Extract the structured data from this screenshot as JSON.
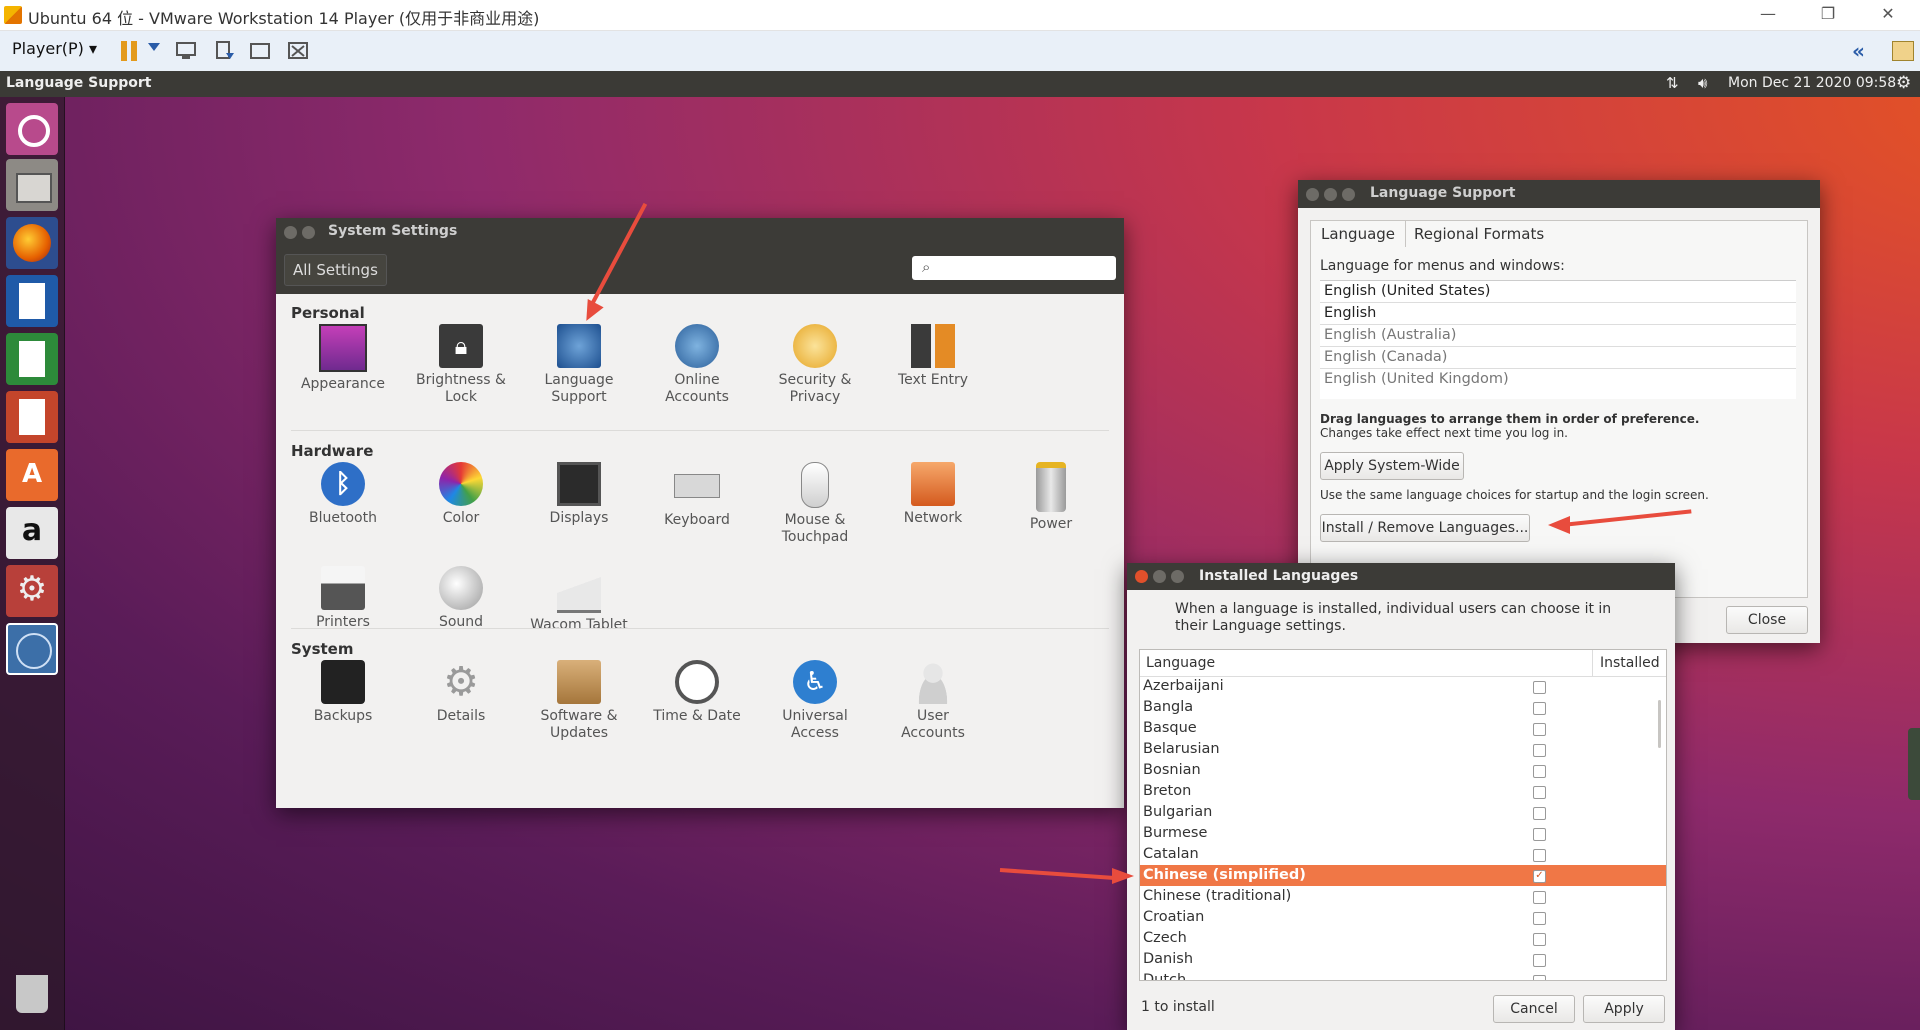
{
  "vm": {
    "window_title": "Ubuntu 64 位 - VMware Workstation 14 Player (仅用于非商业用途)",
    "player_menu": "Player(P) ▾",
    "icons": [
      "pause-icon",
      "dropdown-icon",
      "send-ctrl-alt-del-icon",
      "removable-devices-icon",
      "fullscreen-icon",
      "unity-icon",
      "collapse-icon",
      "library-icon"
    ]
  },
  "topbar": {
    "app_name": "Language Support",
    "clock": "Mon Dec 21 2020 09:58"
  },
  "launcher": [
    "ubuntu-dash-icon",
    "files-icon",
    "firefox-icon",
    "writer-icon",
    "calc-icon",
    "impress-icon",
    "software-center-icon",
    "amazon-icon",
    "system-settings-icon",
    "language-support-icon",
    "trash-icon"
  ],
  "system_settings": {
    "title": "System Settings",
    "all_settings": "All Settings",
    "sections": [
      {
        "name": "Personal",
        "items": [
          {
            "label": "Appearance",
            "icon": "appearance-icon"
          },
          {
            "label": "Brightness &\nLock",
            "icon": "lock-icon"
          },
          {
            "label": "Language\nSupport",
            "icon": "language-icon"
          },
          {
            "label": "Online\nAccounts",
            "icon": "online-accounts-icon"
          },
          {
            "label": "Security &\nPrivacy",
            "icon": "security-icon"
          },
          {
            "label": "Text Entry",
            "icon": "keyboard-layout-icon"
          }
        ]
      },
      {
        "name": "Hardware",
        "items": [
          {
            "label": "Bluetooth",
            "icon": "bluetooth-icon"
          },
          {
            "label": "Color",
            "icon": "color-icon"
          },
          {
            "label": "Displays",
            "icon": "display-icon"
          },
          {
            "label": "Keyboard",
            "icon": "keyboard-icon"
          },
          {
            "label": "Mouse &\nTouchpad",
            "icon": "mouse-icon"
          },
          {
            "label": "Network",
            "icon": "network-icon"
          },
          {
            "label": "Power",
            "icon": "power-icon"
          },
          {
            "label": "Printers",
            "icon": "printer-icon"
          },
          {
            "label": "Sound",
            "icon": "sound-icon"
          },
          {
            "label": "Wacom Tablet",
            "icon": "tablet-icon"
          }
        ]
      },
      {
        "name": "System",
        "items": [
          {
            "label": "Backups",
            "icon": "backup-icon"
          },
          {
            "label": "Details",
            "icon": "gear-icon"
          },
          {
            "label": "Software &\nUpdates",
            "icon": "software-icon"
          },
          {
            "label": "Time & Date",
            "icon": "clock-icon"
          },
          {
            "label": "Universal\nAccess",
            "icon": "accessibility-icon"
          },
          {
            "label": "User\nAccounts",
            "icon": "users-icon"
          }
        ]
      }
    ]
  },
  "language_support": {
    "title": "Language Support",
    "tabs": [
      "Language",
      "Regional Formats"
    ],
    "menus_label": "Language for menus and windows:",
    "languages": [
      "English (United States)",
      "English",
      "English (Australia)",
      "English (Canada)",
      "English (United Kingdom)"
    ],
    "drag_hint": "Drag languages to arrange them in order of preference.",
    "drag_hint2": "Changes take effect next time you log in.",
    "apply_system_wide": "Apply System-Wide",
    "system_wide_hint": "Use the same language choices for startup and the login screen.",
    "install_remove": "Install / Remove Languages...",
    "close": "Close"
  },
  "installed_languages": {
    "title": "Installed Languages",
    "description": "When a language is installed, individual users can choose it in their Language settings.",
    "col_language": "Language",
    "col_installed": "Installed",
    "rows": [
      {
        "name": "Azerbaijani",
        "checked": false
      },
      {
        "name": "Bangla",
        "checked": false
      },
      {
        "name": "Basque",
        "checked": false
      },
      {
        "name": "Belarusian",
        "checked": false
      },
      {
        "name": "Bosnian",
        "checked": false
      },
      {
        "name": "Breton",
        "checked": false
      },
      {
        "name": "Bulgarian",
        "checked": false
      },
      {
        "name": "Burmese",
        "checked": false
      },
      {
        "name": "Catalan",
        "checked": false
      },
      {
        "name": "Chinese (simplified)",
        "checked": true,
        "selected": true
      },
      {
        "name": "Chinese (traditional)",
        "checked": false
      },
      {
        "name": "Croatian",
        "checked": false
      },
      {
        "name": "Czech",
        "checked": false
      },
      {
        "name": "Danish",
        "checked": false
      },
      {
        "name": "Dutch",
        "checked": false
      }
    ],
    "status": "1 to install",
    "cancel": "Cancel",
    "apply": "Apply",
    "highlight_color": "#f07746"
  }
}
